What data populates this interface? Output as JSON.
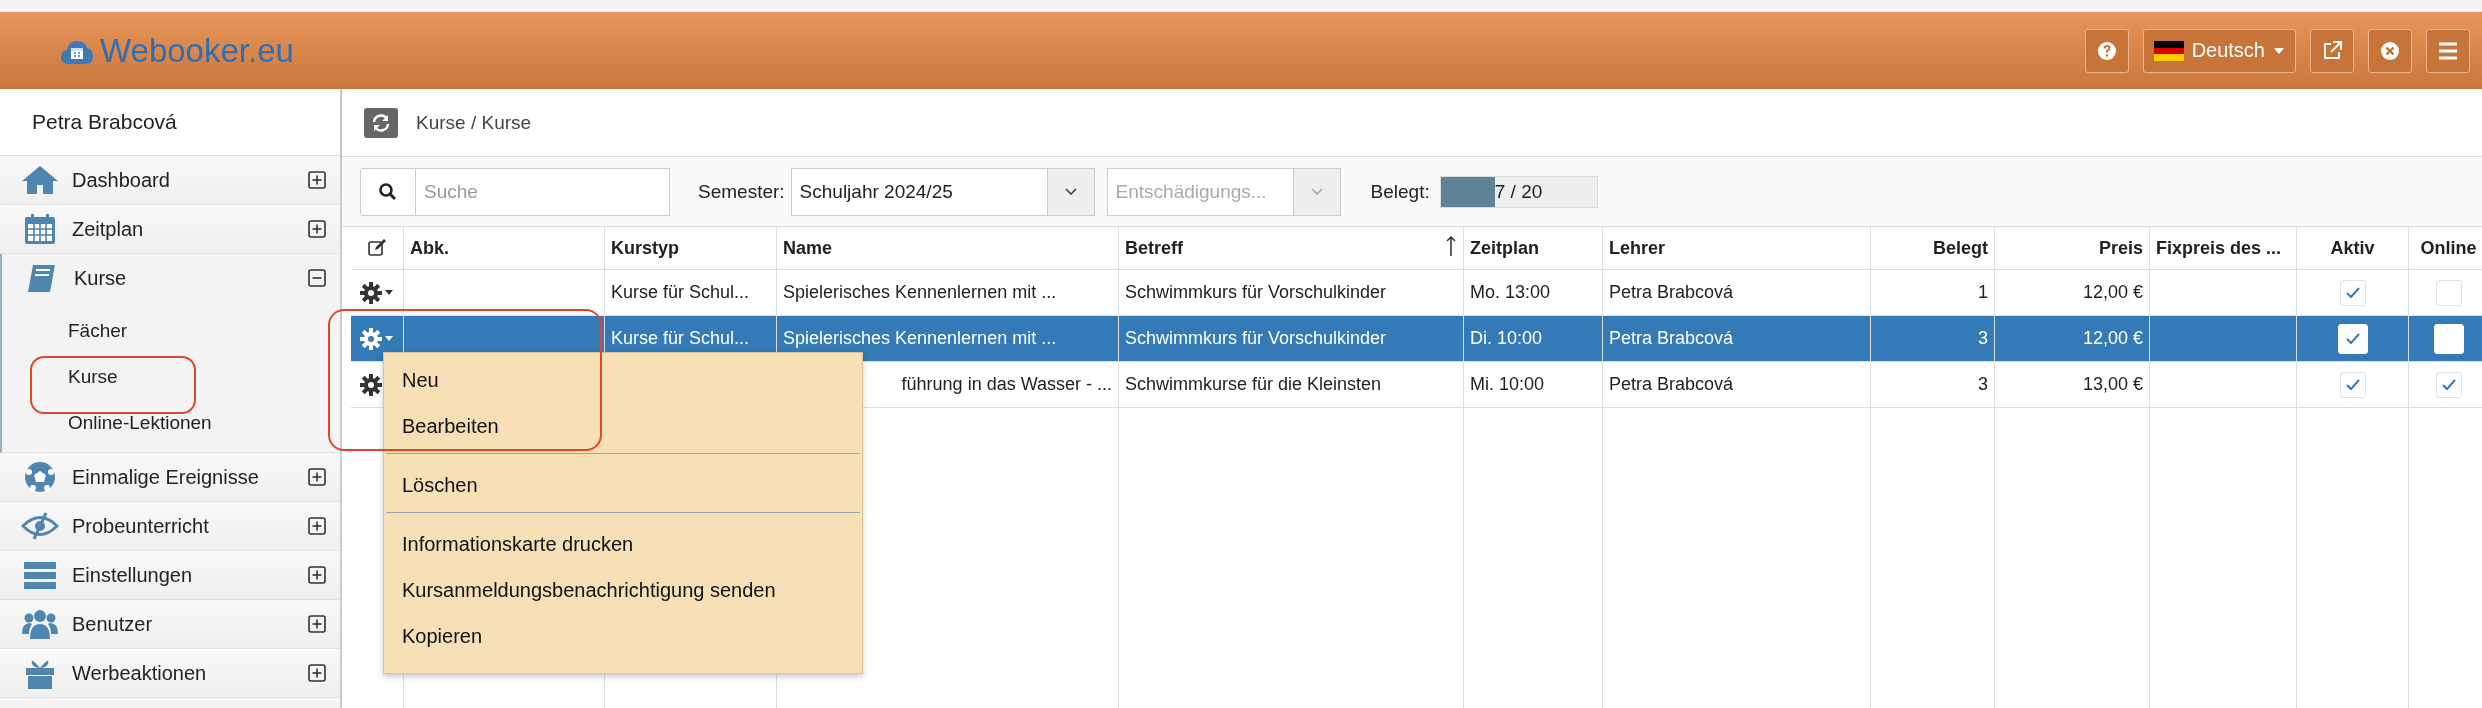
{
  "header": {
    "logo": "Webooker.eu",
    "language": "Deutsch"
  },
  "sidebar": {
    "user": "Petra Brabcová",
    "items": [
      {
        "label": "Dashboard",
        "expanded": false
      },
      {
        "label": "Zeitplan",
        "expanded": false
      },
      {
        "label": "Kurse",
        "expanded": true,
        "children": [
          {
            "label": "Fächer",
            "circled": false
          },
          {
            "label": "Kurse",
            "circled": true
          },
          {
            "label": "Online-Lektionen",
            "circled": false
          }
        ]
      },
      {
        "label": "Einmalige Ereignisse",
        "expanded": false
      },
      {
        "label": "Probeunterricht",
        "expanded": false
      },
      {
        "label": "Einstellungen",
        "expanded": false
      },
      {
        "label": "Benutzer",
        "expanded": false
      },
      {
        "label": "Werbeaktionen",
        "expanded": false
      }
    ]
  },
  "breadcrumb": "Kurse / Kurse",
  "toolbar": {
    "search": {
      "placeholder": "Suche"
    },
    "semester_label": "Semester:",
    "semester": "Schuljahr 2024/25",
    "compensation": {
      "placeholder": "Entschädigungs...",
      "disabled": true
    },
    "occupancy_label": "Belegt:",
    "occupancy": {
      "level": 0.35,
      "reading": "7 / 20"
    }
  },
  "table": {
    "columns": [
      {
        "label": "Abk."
      },
      {
        "label": "Kurstyp"
      },
      {
        "label": "Name"
      },
      {
        "label": "Betreff",
        "sorted": true
      },
      {
        "label": "Zeitplan"
      },
      {
        "label": "Lehrer"
      },
      {
        "label": "Belegt"
      },
      {
        "label": "Preis"
      },
      {
        "label": "Fixpreis des ..."
      },
      {
        "label": "Aktiv"
      },
      {
        "label": "Online"
      }
    ],
    "rows": [
      {
        "selected": false,
        "kurstyp": "Kurse für Schul...",
        "name": "Spielerisches Kennenlernen mit ...",
        "name_covered": false,
        "betreff": "Schwimmkurs für Vorschulkinder",
        "zeitplan": "Mo. 13:00",
        "lehrer": "Petra Brabcová",
        "belegt": "1",
        "preis": "12,00 €",
        "aktiv": true,
        "online": false
      },
      {
        "selected": true,
        "kurstyp": "Kurse für Schul...",
        "name": "Spielerisches Kennenlernen mit ...",
        "name_covered": false,
        "betreff": "Schwimmkurs für Vorschulkinder",
        "zeitplan": "Di. 10:00",
        "lehrer": "Petra Brabcová",
        "belegt": "3",
        "preis": "12,00 €",
        "aktiv": true,
        "online": false
      },
      {
        "selected": false,
        "name": "führung in das Wasser - ...",
        "name_covered": true,
        "betreff": "Schwimmkurse für die Kleinsten",
        "zeitplan": "Mi. 10:00",
        "lehrer": "Petra Brabcová",
        "belegt": "3",
        "preis": "13,00 €",
        "aktiv": true,
        "online": true
      }
    ]
  },
  "context_menu": {
    "circled": true,
    "sections": [
      {
        "items": [
          "Neu",
          "Bearbeiten"
        ]
      },
      {
        "items": [
          "Löschen"
        ]
      },
      {
        "items": [
          "Informationskarte drucken",
          "Kursanmeldungsbenachrichtigung senden",
          "Kopieren"
        ]
      }
    ]
  }
}
